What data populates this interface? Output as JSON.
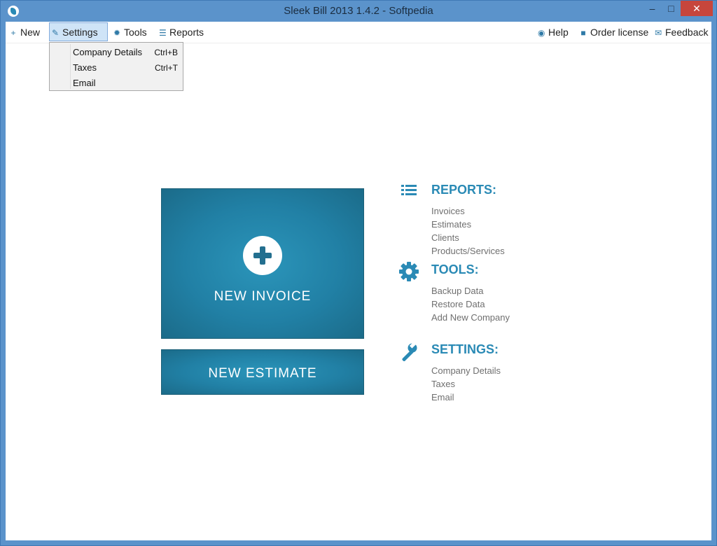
{
  "window": {
    "title": "Sleek Bill 2013 1.4.2 - Softpedia",
    "controls": {
      "minimize": "–",
      "maximize": "□",
      "close": "✕"
    }
  },
  "menubar": {
    "left": [
      {
        "label": "New",
        "icon": "plus-icon"
      },
      {
        "label": "Settings",
        "icon": "wrench-icon"
      },
      {
        "label": "Tools",
        "icon": "gear-icon"
      },
      {
        "label": "Reports",
        "icon": "list-icon"
      }
    ],
    "right": [
      {
        "label": "Help",
        "icon": "globe-icon"
      },
      {
        "label": "Order license",
        "icon": "lock-icon"
      },
      {
        "label": "Feedback",
        "icon": "mail-icon"
      }
    ]
  },
  "settings_dropdown": [
    {
      "label": "Company Details",
      "shortcut": "Ctrl+B"
    },
    {
      "label": "Taxes",
      "shortcut": "Ctrl+T"
    },
    {
      "label": "Email",
      "shortcut": ""
    }
  ],
  "tiles": {
    "new_invoice": "NEW INVOICE",
    "new_estimate": "NEW ESTIMATE"
  },
  "sections": {
    "reports": {
      "heading": "REPORTS:",
      "icon": "list-icon",
      "links": [
        "Invoices",
        "Estimates",
        "Clients",
        "Products/Services"
      ]
    },
    "tools": {
      "heading": "TOOLS:",
      "icon": "gear-icon",
      "links": [
        "Backup Data",
        "Restore Data",
        "Add New Company"
      ]
    },
    "settings": {
      "heading": "SETTINGS:",
      "icon": "wrench-icon",
      "links": [
        "Company Details",
        "Taxes",
        "Email"
      ]
    }
  },
  "colors": {
    "accent": "#2a8ab5",
    "titlebar": "#5b93cb",
    "tile": "#2180a5",
    "close": "#c7463c"
  }
}
